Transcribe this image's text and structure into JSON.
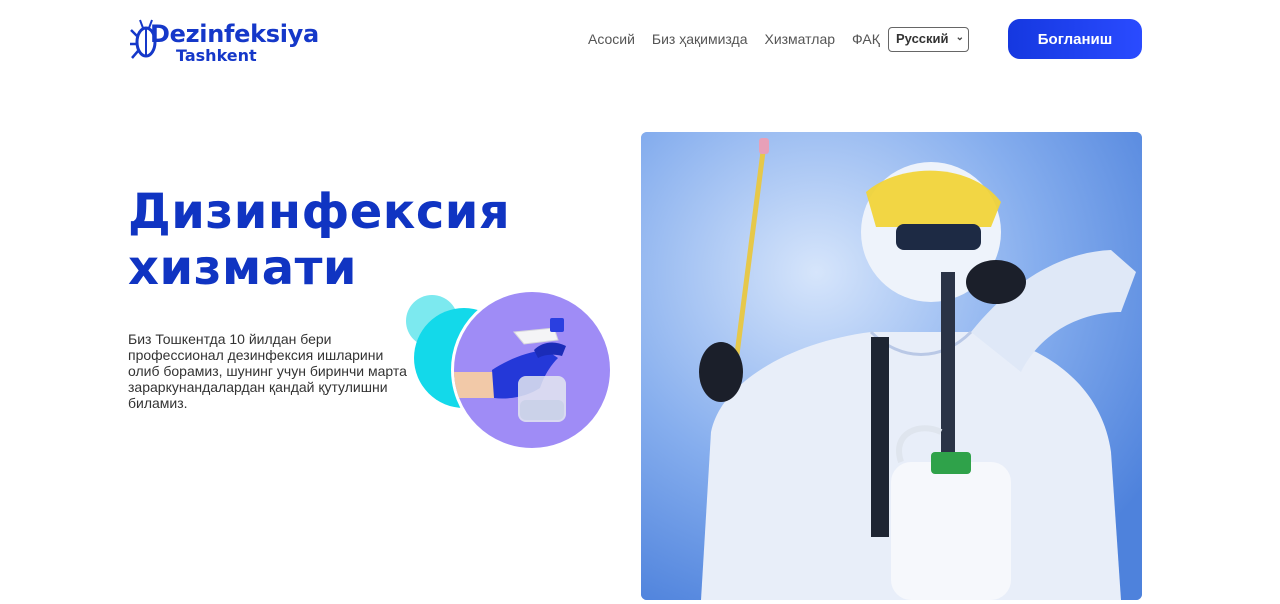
{
  "header": {
    "logo": {
      "title": "Dezinfeksiya",
      "subtitle": "Tashkent"
    },
    "nav": [
      {
        "label": "Асосий"
      },
      {
        "label": "Биз ҳақимизда"
      },
      {
        "label": "Хизматлар"
      },
      {
        "label": "ФАҚ"
      }
    ],
    "language": {
      "selected": "Русский"
    },
    "cta_label": "Богланиш"
  },
  "hero": {
    "title_line1": "Дизинфексия",
    "title_line2": "хизмати",
    "description": "Биз Тошкентда 10 йилдан бери профессионал дезинфексия ишларини олиб борамиз, шунинг учун биринчи марта зараркунандалардан қандай қутулишни биламиз."
  },
  "colors": {
    "brand": "#1538c9",
    "accent_purple": "#9f8cf6",
    "accent_cyan": "#13d9ea"
  }
}
